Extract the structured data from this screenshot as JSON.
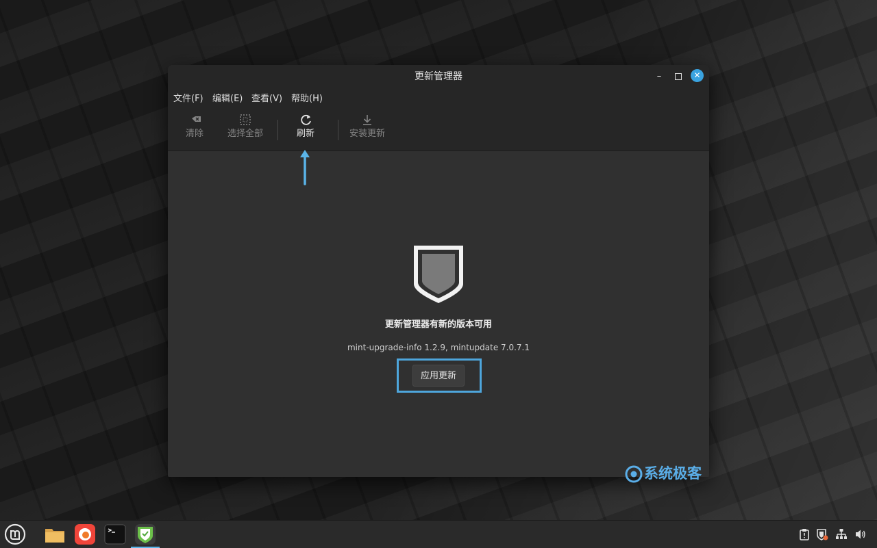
{
  "window": {
    "title": "更新管理器",
    "controls": {
      "minimize": "–",
      "maximize": "",
      "close": "✕"
    }
  },
  "menubar": {
    "items": [
      {
        "label": "文件(F)"
      },
      {
        "label": "编辑(E)"
      },
      {
        "label": "查看(V)"
      },
      {
        "label": "帮助(H)"
      }
    ]
  },
  "toolbar": {
    "clear": {
      "label": "清除",
      "icon": "clear-icon",
      "enabled": false
    },
    "select_all": {
      "label": "选择全部",
      "icon": "select-all-icon",
      "enabled": false
    },
    "refresh": {
      "label": "刷新",
      "icon": "refresh-icon",
      "enabled": true
    },
    "install": {
      "label": "安装更新",
      "icon": "download-icon",
      "enabled": false
    }
  },
  "main": {
    "icon": "shield-icon",
    "message_title": "更新管理器有新的版本可用",
    "message_detail": "mint-upgrade-info 1.2.9, mintupdate 7.0.7.1",
    "apply_button": "应用更新"
  },
  "annotations": {
    "arrow_color": "#5ab4e8",
    "highlight_color": "#4ea6dc"
  },
  "watermark": {
    "text": "系统极客",
    "color": "#5aaee8"
  },
  "taskbar": {
    "apps": [
      {
        "name": "menu-icon"
      },
      {
        "name": "files-icon"
      },
      {
        "name": "firefox-icon"
      },
      {
        "name": "terminal-icon"
      },
      {
        "name": "update-manager-icon",
        "active": true
      }
    ],
    "tray": [
      "clipboard-icon",
      "update-shield-icon",
      "network-icon",
      "volume-icon"
    ]
  }
}
